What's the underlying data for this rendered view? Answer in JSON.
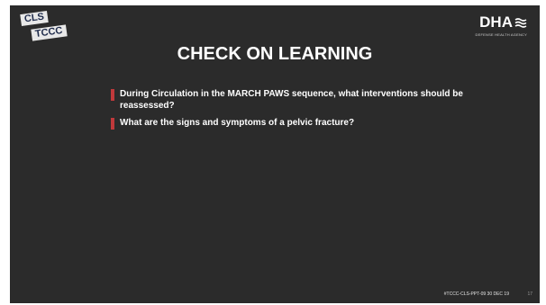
{
  "logos": {
    "cls_line1": "CLS",
    "cls_line2": "TCCC",
    "dha_text": "DHA",
    "dha_sub": "DEFENSE HEALTH AGENCY",
    "dha_icon": "stars-stripes-flag-icon"
  },
  "slide": {
    "title": "CHECK ON LEARNING",
    "bullets": [
      "During Circulation in the MARCH PAWS sequence, what interventions should be reassessed?",
      "What are the signs and symptoms of a pelvic fracture?"
    ],
    "footer": "#TCCC-CLS-PPT-09 30 DEC 19",
    "page_number": "17"
  },
  "colors": {
    "background": "#2b2b2b",
    "bullet_accent": "#c0393b",
    "text": "#ffffff"
  }
}
